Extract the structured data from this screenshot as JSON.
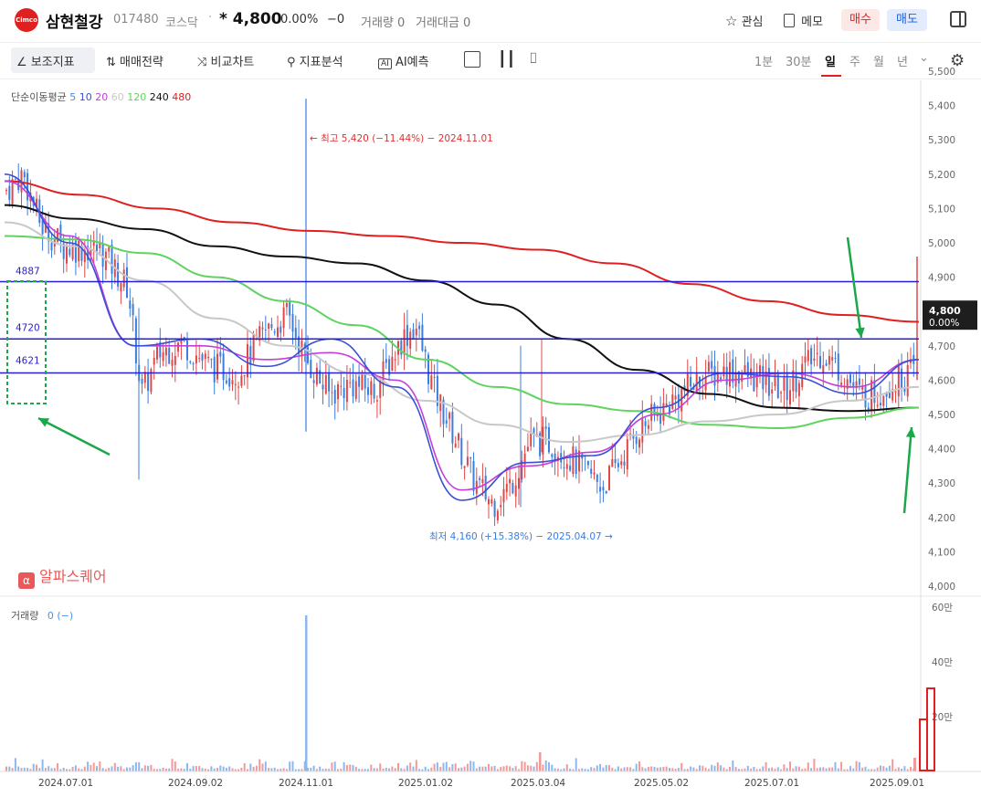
{
  "header": {
    "logo_text": "Cimco",
    "name": "삼현철강",
    "code": "017480",
    "market": "코스닥",
    "separator": "·",
    "price": "* 4,800",
    "change_pct": "0.00%",
    "change": "−0",
    "volume": "거래량 0",
    "amount": "거래대금 0",
    "watch_label": "관심",
    "memo_label": "메모",
    "buy_label": "매수",
    "sell_label": "매도"
  },
  "toolbar": {
    "indicator": "보조지표",
    "strategy": "매매전략",
    "compare": "비교차트",
    "pattern": "지표분석",
    "ai": "AI예측",
    "timeframes": [
      "1분",
      "30분",
      "일",
      "주",
      "월",
      "년"
    ],
    "active_timeframe": "일"
  },
  "legend": {
    "title": "단순이동평균",
    "periods": [
      {
        "label": "5",
        "color": "#4a90e2"
      },
      {
        "label": "10",
        "color": "#3b4fd6"
      },
      {
        "label": "20",
        "color": "#c33fd9"
      },
      {
        "label": "60",
        "color": "#c8c8c8"
      },
      {
        "label": "120",
        "color": "#5fd35f"
      },
      {
        "label": "240",
        "color": "#111111"
      },
      {
        "label": "480",
        "color": "#e02020"
      }
    ]
  },
  "annotations": {
    "high": "← 최고 5,420 (−11.44%) − 2024.11.01",
    "low": "최저 4,160 (+15.38%) − 2025.04.07 →",
    "levels": [
      "4887",
      "4720",
      "4621"
    ]
  },
  "current_price": {
    "price": "4,800",
    "pct": "0.00%"
  },
  "watermark": "알파스퀘어",
  "volume_legend": {
    "label": "거래량",
    "value": "0 (−)"
  },
  "chart_data": {
    "type": "candlestick",
    "price_axis": {
      "ticks": [
        "5,500",
        "5,400",
        "5,300",
        "5,200",
        "5,100",
        "5,000",
        "4,900",
        "4,800",
        "4,700",
        "4,600",
        "4,500",
        "4,400",
        "4,300",
        "4,200",
        "4,100",
        "4,000"
      ],
      "ylim": [
        4000,
        5500
      ]
    },
    "volume_axis": {
      "ticks": [
        "60만",
        "40만",
        "20만"
      ],
      "ylim": [
        0,
        600000
      ]
    },
    "x_ticks": [
      "2024.07.01",
      "2024.09.02",
      "2024.11.01",
      "2025.01.02",
      "2025.03.04",
      "2025.05.02",
      "2025.07.01",
      "2025.09.01"
    ],
    "horizontal_levels": [
      4887,
      4720,
      4621
    ],
    "high": {
      "value": 5420,
      "date": "2024.11.01"
    },
    "low": {
      "value": 4160,
      "date": "2025.04.07"
    },
    "last_price": 4800,
    "series": [
      {
        "name": "480",
        "color": "#e02020",
        "values": [
          5180,
          5140,
          5100,
          5060,
          5035,
          5020,
          5000,
          4980,
          4940,
          4880,
          4830,
          4790,
          4770
        ]
      },
      {
        "name": "240",
        "color": "#111111",
        "values": [
          5110,
          5070,
          5040,
          4990,
          4960,
          4940,
          4890,
          4820,
          4720,
          4630,
          4560,
          4520,
          4510,
          4520
        ]
      },
      {
        "name": "120",
        "color": "#5fd35f",
        "values": [
          5020,
          5010,
          4970,
          4900,
          4830,
          4760,
          4660,
          4580,
          4530,
          4510,
          4470,
          4460,
          4490,
          4520
        ]
      },
      {
        "name": "60",
        "color": "#c8c8c8",
        "values": [
          5060,
          4990,
          4890,
          4780,
          4700,
          4620,
          4540,
          4470,
          4420,
          4440,
          4480,
          4500,
          4540,
          4580
        ]
      },
      {
        "name": "20",
        "color": "#c33fd9",
        "values": [
          5180,
          5020,
          4700,
          4700,
          4660,
          4680,
          4600,
          4280,
          4350,
          4390,
          4500,
          4600,
          4620,
          4580,
          4660
        ]
      },
      {
        "name": "10",
        "color": "#3b4fd6",
        "values": [
          5200,
          5000,
          4700,
          4720,
          4640,
          4720,
          4580,
          4250,
          4360,
          4380,
          4520,
          4620,
          4610,
          4560,
          4660
        ]
      }
    ]
  }
}
